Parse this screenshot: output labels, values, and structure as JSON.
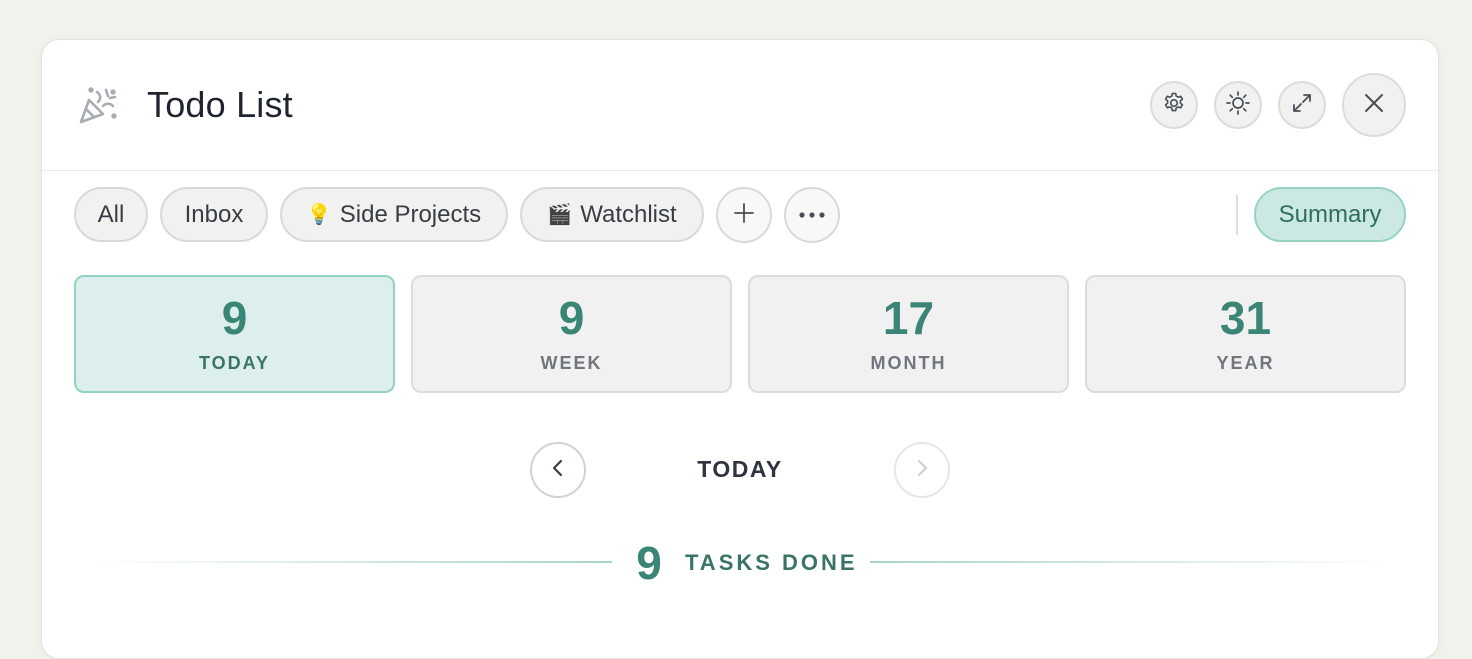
{
  "window": {
    "title": "Todo List",
    "app_icon": "party-popper-icon"
  },
  "header_buttons": [
    {
      "name": "settings",
      "icon": "gear-icon"
    },
    {
      "name": "theme",
      "icon": "sun-icon"
    },
    {
      "name": "expand",
      "icon": "expand-icon"
    },
    {
      "name": "close",
      "icon": "close-icon"
    }
  ],
  "tabs": [
    {
      "label": "All",
      "emoji": ""
    },
    {
      "label": "Inbox",
      "emoji": ""
    },
    {
      "label": "Side Projects",
      "emoji": "💡"
    },
    {
      "label": "Watchlist",
      "emoji": "🎬"
    }
  ],
  "tab_actions": {
    "add_icon": "plus-icon",
    "more_icon": "more-dots-icon"
  },
  "summary_label": "Summary",
  "stats": [
    {
      "value": "9",
      "label": "TODAY",
      "active": true
    },
    {
      "value": "9",
      "label": "WEEK",
      "active": false
    },
    {
      "value": "17",
      "label": "MONTH",
      "active": false
    },
    {
      "value": "31",
      "label": "YEAR",
      "active": false
    }
  ],
  "period_nav": {
    "label": "TODAY",
    "prev_icon": "chevron-left-icon",
    "next_icon": "chevron-right-icon",
    "next_disabled": true
  },
  "tasks_done": {
    "count": "9",
    "label": "TASKS DONE"
  },
  "colors": {
    "accent": "#3a8575",
    "accent_bg": "#dcefec",
    "summary_bg": "#cbe9e2",
    "background": "#f2f1ec"
  }
}
